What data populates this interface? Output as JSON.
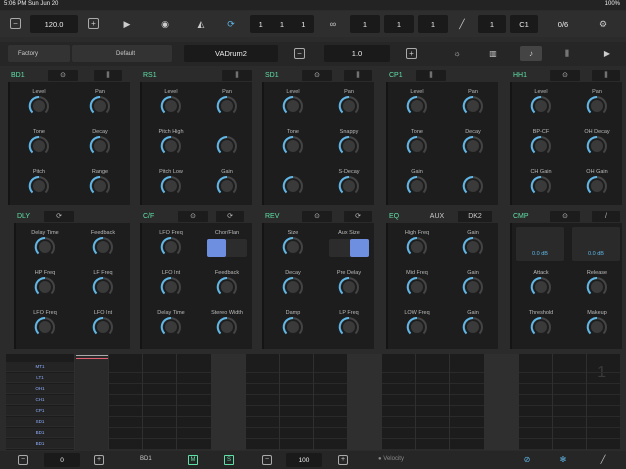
{
  "status": {
    "time": "5:06 PM  Sun Jun 20",
    "right": "100%"
  },
  "transport": {
    "tempo": "120.0",
    "minus": "−",
    "plus": "+",
    "play_icon": "▶",
    "record_icon": "◉",
    "metronome_icon": "◭",
    "loop_icon": "⟳",
    "position": [
      "1",
      "1",
      "1"
    ],
    "link_icon": "∞",
    "loop_values": [
      "1",
      "1",
      "1"
    ],
    "pencil_icon": "╱",
    "step": "1",
    "note": "C1",
    "fraction": "0/6",
    "settings_icon": "⚙"
  },
  "presets": {
    "factory": "Factory",
    "default": "Default",
    "kit_name": "VADrum2",
    "value": "1.0",
    "minus": "−",
    "plus": "+",
    "icons": [
      "☼",
      "▥",
      "♪",
      "⫼",
      "▶"
    ]
  },
  "sections": {
    "bd1": {
      "name": "BD1",
      "knobs": [
        [
          "Level",
          "Pan"
        ],
        [
          "Tone",
          "Decay"
        ],
        [
          "Pitch",
          "Range"
        ]
      ]
    },
    "rs1": {
      "name": "RS1",
      "knobs": [
        [
          "Level",
          "Pan"
        ],
        [
          "Pitch High",
          ""
        ],
        [
          "Pitch Low",
          "Gain"
        ]
      ]
    },
    "sd1": {
      "name": "SD1",
      "knobs": [
        [
          "Level",
          "Pan"
        ],
        [
          "Tone",
          "Snappy"
        ],
        [
          "",
          "S-Decay"
        ]
      ]
    },
    "cp1": {
      "name": "CP1",
      "knobs": [
        [
          "Level",
          "Pan"
        ],
        [
          "Tone",
          "Decay"
        ],
        [
          "Gain",
          ""
        ]
      ]
    },
    "hh1": {
      "name": "HH1",
      "knobs": [
        [
          "Level",
          "Pan"
        ],
        [
          "BP-CF",
          "OH Decay"
        ],
        [
          "CH Gain",
          "OH Gain"
        ]
      ]
    },
    "dly": {
      "name": "DLY",
      "knobs": [
        [
          "Delay Time",
          "Feedback"
        ],
        [
          "HP Freq",
          "LF Freq"
        ],
        [
          "LFO Freq",
          "LFO Int"
        ]
      ]
    },
    "cf": {
      "name": "C/F",
      "knobs": [
        [
          "LFO Freq",
          "Chor/Flan"
        ],
        [
          "LFO Int",
          "Feedback"
        ],
        [
          "Delay Time",
          "Stereo Width"
        ]
      ]
    },
    "rev": {
      "name": "REV",
      "knobs": [
        [
          "Size",
          "Aux Size"
        ],
        [
          "Decay",
          "Pre Delay"
        ],
        [
          "Damp",
          "LP Freq"
        ]
      ]
    },
    "eq": {
      "name": "EQ",
      "tabs": [
        "AUX",
        "DK2"
      ],
      "knobs": [
        [
          "High Freq",
          "Gain"
        ],
        [
          "Mid Freq",
          "Gain"
        ],
        [
          "LOW Freq",
          "Gain"
        ]
      ]
    },
    "cmp": {
      "name": "CMP",
      "meters": [
        "0.0 dB",
        "0.0 dB"
      ],
      "knobs": [
        [
          "",
          ""
        ],
        [
          "Attack",
          "Release"
        ],
        [
          "Threshold",
          "Makeup"
        ]
      ]
    }
  },
  "sequencer": {
    "tracks": [
      "MT1",
      "LT1",
      "OH1",
      "CH1",
      "CP1",
      "SD1",
      "BD1",
      "BD1"
    ],
    "page": "1"
  },
  "bottom": {
    "minus": "−",
    "plus": "+",
    "value": "0",
    "track": "BD1",
    "m": "M",
    "s": "S",
    "velocity_value": "100",
    "velocity_label": "Velocity",
    "icons": [
      "⊘",
      "✻",
      "╱"
    ]
  },
  "colors": {
    "accent": "#5fb7e8",
    "label": "#5fe0a8",
    "toggle": "#6e8fe0",
    "track": "#8fb0ff"
  }
}
